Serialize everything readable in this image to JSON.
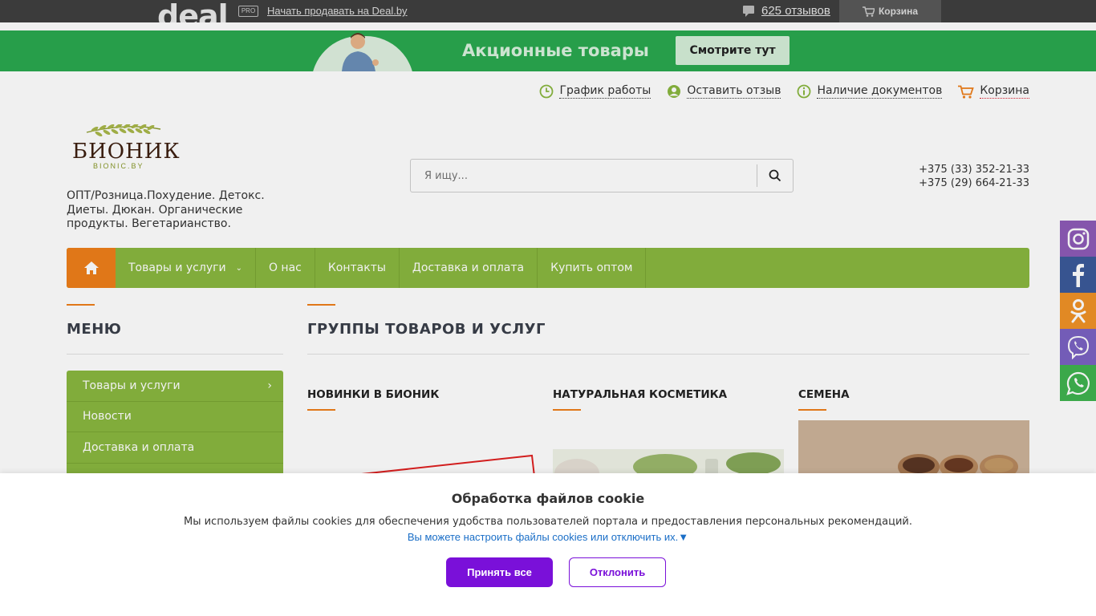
{
  "topbar": {
    "logo": "deal",
    "pro": "PRO",
    "sell_link": "Начать продавать на Deal.by",
    "reviews": "625 отзывов",
    "cart": "Корзина"
  },
  "banner": {
    "title": "Акционные товары",
    "button": "Смотрите тут"
  },
  "utility_links": [
    {
      "label": "График работы",
      "icon": "clock-icon"
    },
    {
      "label": "Оставить отзыв",
      "icon": "user-icon"
    },
    {
      "label": "Наличие документов",
      "icon": "info-icon"
    },
    {
      "label": "Корзина",
      "icon": "cart-icon"
    }
  ],
  "brand": {
    "name": "БИОНИК",
    "sub": "BIONIC.BY",
    "tagline": "ОПТ/Розница.Похудение. Детокс. Диеты. Дюкан. Органические продукты. Вегетарианство."
  },
  "search": {
    "placeholder": "Я ищу..."
  },
  "phones": [
    "+375 (33) 352-21-33",
    "+375 (29) 664-21-33"
  ],
  "nav": {
    "items": [
      "Товары и услуги",
      "О нас",
      "Контакты",
      "Доставка и оплата",
      "Купить оптом"
    ]
  },
  "sidebar": {
    "title": "МЕНЮ",
    "items": [
      "Товары и услуги",
      "Новости",
      "Доставка и оплата"
    ]
  },
  "main": {
    "title": "ГРУППЫ ТОВАРОВ И УСЛУГ",
    "categories": [
      "НОВИНКИ В БИОНИК",
      "НАТУРАЛЬНАЯ КОСМЕТИКА",
      "СЕМЕНА"
    ]
  },
  "social": [
    "instagram-icon",
    "facebook-icon",
    "odnoklassniki-icon",
    "viber-icon",
    "whatsapp-icon"
  ],
  "colors": {
    "nav_green": "#8ab73f",
    "accent_orange": "#ef7f1a",
    "banner_green": "#2aa84f",
    "cookie_purple": "#7a10d9"
  },
  "cookie": {
    "title": "Обработка файлов cookie",
    "text": "Мы используем файлы cookies для обеспечения удобства пользователей портала и предоставления персональных рекомендаций.",
    "link": "Вы можете настроить файлы cookies или отключить их.▼",
    "accept": "Принять все",
    "decline": "Отклонить"
  }
}
